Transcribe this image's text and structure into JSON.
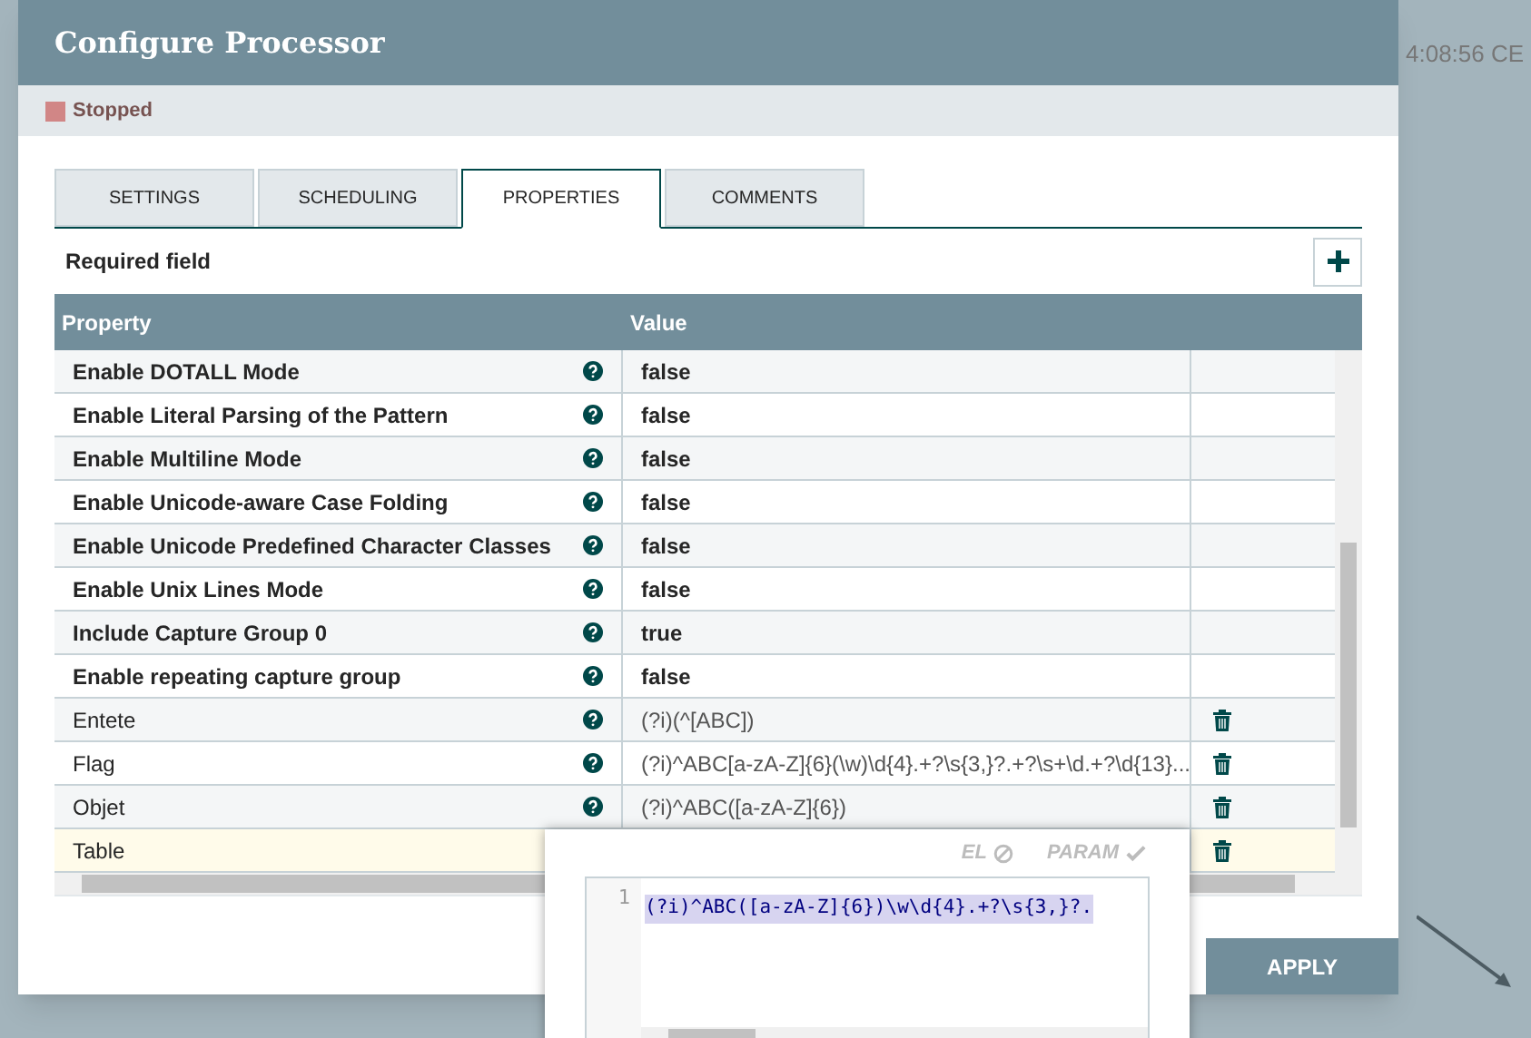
{
  "background": {
    "clock": "4:08:56 CE"
  },
  "dialog": {
    "title": "Configure Processor",
    "status": {
      "label": "Stopped",
      "color": "#d18686"
    },
    "tabs": [
      {
        "label": "SETTINGS",
        "selected": false
      },
      {
        "label": "SCHEDULING",
        "selected": false
      },
      {
        "label": "PROPERTIES",
        "selected": true
      },
      {
        "label": "COMMENTS",
        "selected": false
      }
    ],
    "required_note": "Required field",
    "table": {
      "columns": [
        "Property",
        "Value"
      ],
      "rows": [
        {
          "name": "Enable DOTALL Mode",
          "value": "false",
          "required": true,
          "deletable": false,
          "selected": false
        },
        {
          "name": "Enable Literal Parsing of the Pattern",
          "value": "false",
          "required": true,
          "deletable": false,
          "selected": false
        },
        {
          "name": "Enable Multiline Mode",
          "value": "false",
          "required": true,
          "deletable": false,
          "selected": false
        },
        {
          "name": "Enable Unicode-aware Case Folding",
          "value": "false",
          "required": true,
          "deletable": false,
          "selected": false
        },
        {
          "name": "Enable Unicode Predefined Character Classes",
          "value": "false",
          "required": true,
          "deletable": false,
          "selected": false
        },
        {
          "name": "Enable Unix Lines Mode",
          "value": "false",
          "required": true,
          "deletable": false,
          "selected": false
        },
        {
          "name": "Include Capture Group 0",
          "value": "true",
          "required": true,
          "deletable": false,
          "selected": false
        },
        {
          "name": "Enable repeating capture group",
          "value": "false",
          "required": true,
          "deletable": false,
          "selected": false
        },
        {
          "name": "Entete",
          "value": "(?i)(^[ABC])",
          "required": false,
          "deletable": true,
          "selected": false
        },
        {
          "name": "Flag",
          "value": "(?i)^ABC[a-zA-Z]{6}(\\w)\\d{4}.+?\\s{3,}?.+?\\s+\\d.+?\\d{13}...",
          "required": false,
          "deletable": true,
          "selected": false
        },
        {
          "name": "Objet",
          "value": "(?i)^ABC([a-zA-Z]{6})",
          "required": false,
          "deletable": true,
          "selected": false
        },
        {
          "name": "Table",
          "value": "",
          "required": false,
          "deletable": true,
          "selected": true
        }
      ]
    },
    "apply_button": "APPLY"
  },
  "editor_popup": {
    "el_label": "EL",
    "el_supported": false,
    "param_label": "PARAM",
    "param_supported": true,
    "lines": [
      {
        "number": "1",
        "text": "(?i)^ABC([a-zA-Z]{6})\\w\\d{4}.+?\\s{3,}?."
      }
    ]
  }
}
